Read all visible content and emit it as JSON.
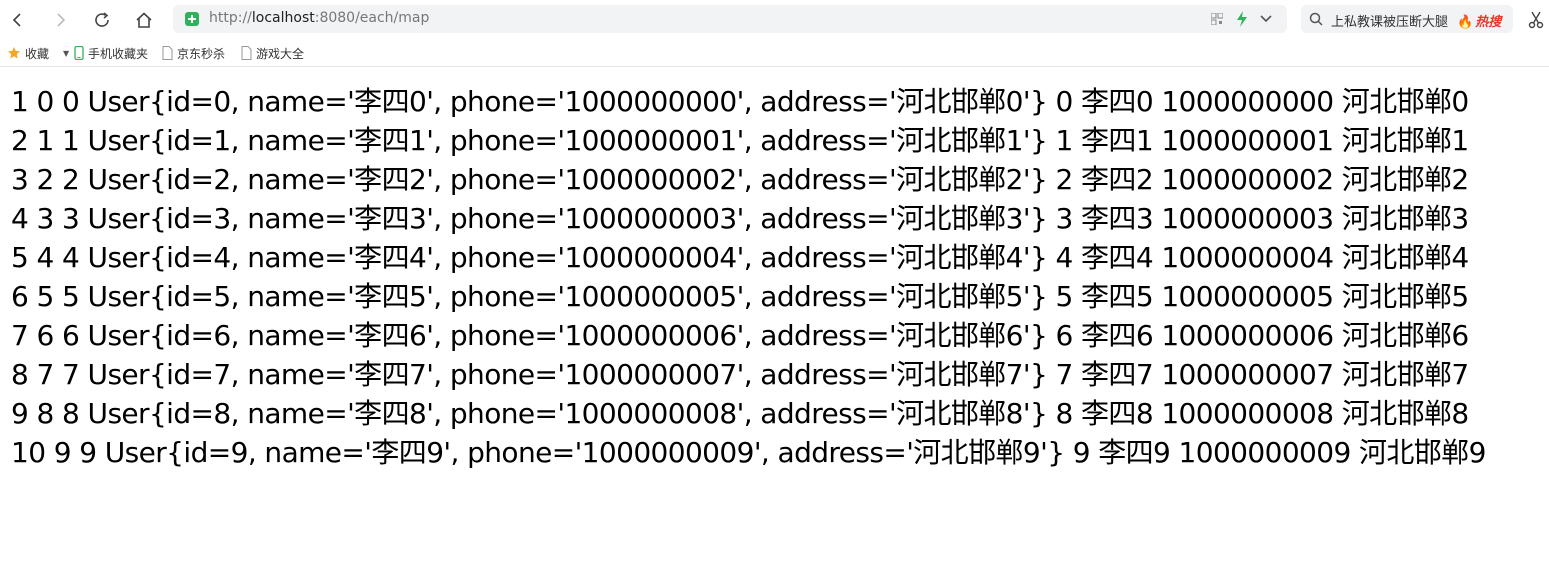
{
  "browser": {
    "url_prefix": "http://",
    "url_host": "localhost",
    "url_rest": ":8080/each/map",
    "search_text": "上私教课被压断大腿",
    "hot_label": "热搜"
  },
  "bookmarks": [
    {
      "label": "收藏"
    },
    {
      "label": "手机收藏夹"
    },
    {
      "label": "京东秒杀"
    },
    {
      "label": "游戏大全"
    }
  ],
  "rows": [
    "1 0 0 User{id=0, name='李四0', phone='1000000000', address='河北邯郸0'} 0 李四0 1000000000 河北邯郸0",
    "2 1 1 User{id=1, name='李四1', phone='1000000001', address='河北邯郸1'} 1 李四1 1000000001 河北邯郸1",
    "3 2 2 User{id=2, name='李四2', phone='1000000002', address='河北邯郸2'} 2 李四2 1000000002 河北邯郸2",
    "4 3 3 User{id=3, name='李四3', phone='1000000003', address='河北邯郸3'} 3 李四3 1000000003 河北邯郸3",
    "5 4 4 User{id=4, name='李四4', phone='1000000004', address='河北邯郸4'} 4 李四4 1000000004 河北邯郸4",
    "6 5 5 User{id=5, name='李四5', phone='1000000005', address='河北邯郸5'} 5 李四5 1000000005 河北邯郸5",
    "7 6 6 User{id=6, name='李四6', phone='1000000006', address='河北邯郸6'} 6 李四6 1000000006 河北邯郸6",
    "8 7 7 User{id=7, name='李四7', phone='1000000007', address='河北邯郸7'} 7 李四7 1000000007 河北邯郸7",
    "9 8 8 User{id=8, name='李四8', phone='1000000008', address='河北邯郸8'} 8 李四8 1000000008 河北邯郸8",
    "10 9 9 User{id=9, name='李四9', phone='1000000009', address='河北邯郸9'} 9 李四9 1000000009 河北邯郸9"
  ],
  "colors": {
    "secure_green": "#2fb35a",
    "hot_red": "#e8382f",
    "star_orange": "#f5a623"
  }
}
